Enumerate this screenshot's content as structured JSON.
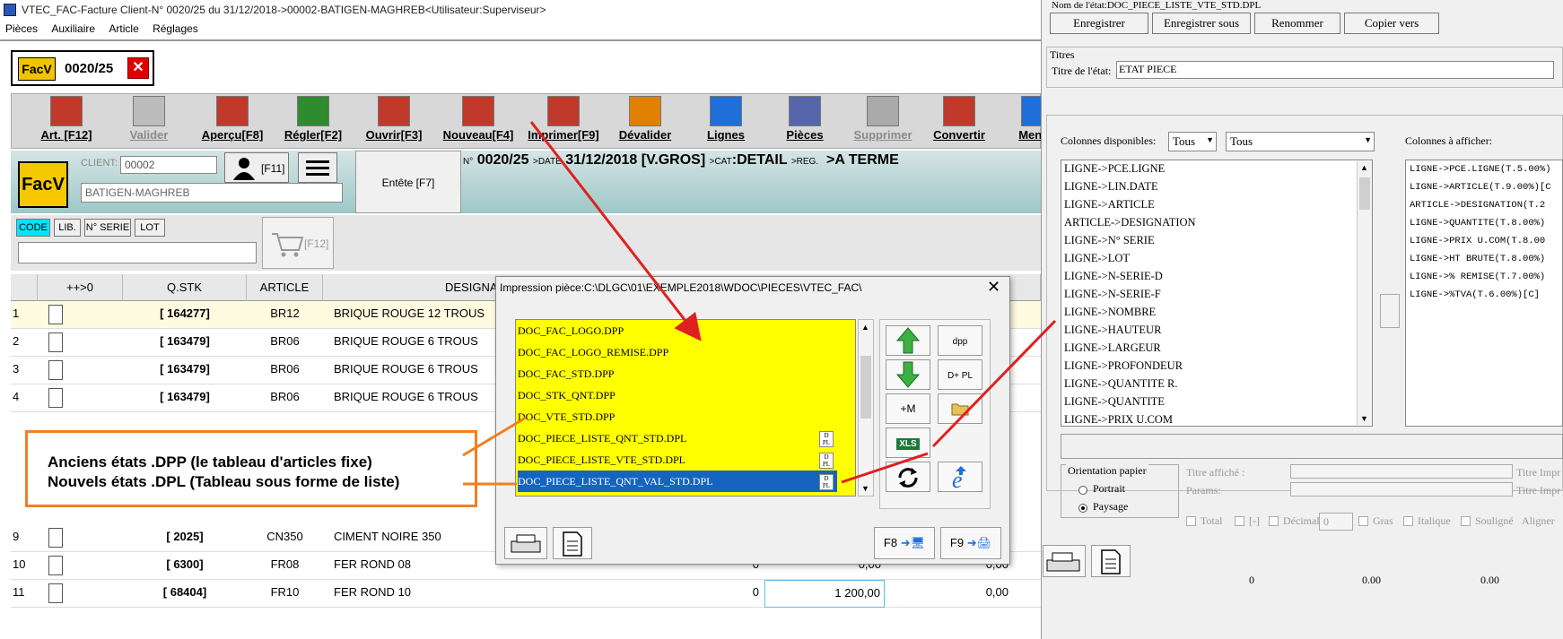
{
  "window": {
    "title": "VTEC_FAC-Facture Client-N° 0020/25 du 31/12/2018->00002-BATIGEN-MAGHREB<Utilisateur:Superviseur>",
    "menu": [
      "Pièces",
      "Auxiliaire",
      "Article",
      "Réglages"
    ]
  },
  "doc_tab": {
    "badge": "FacV",
    "number": "0020/25"
  },
  "toolbar": [
    {
      "label": "Art. [F12]",
      "icon": "article-icon",
      "enabled": true
    },
    {
      "label": "Valider",
      "icon": "validate-icon",
      "enabled": false
    },
    {
      "label": "Aperçu[F8]",
      "icon": "preview-icon",
      "enabled": true
    },
    {
      "label": "Régler[F2]",
      "icon": "money-icon",
      "enabled": true
    },
    {
      "label": "Ouvrir[F3]",
      "icon": "open-icon",
      "enabled": true
    },
    {
      "label": "Nouveau[F4]",
      "icon": "new-icon",
      "enabled": true
    },
    {
      "label": "Imprimer[F9]",
      "icon": "printer-icon",
      "enabled": true
    },
    {
      "label": "Dévalider",
      "icon": "unvalidate-icon",
      "enabled": true
    },
    {
      "label": "Lignes",
      "icon": "search-icon",
      "enabled": true
    },
    {
      "label": "Pièces",
      "icon": "grid-icon",
      "enabled": true
    },
    {
      "label": "Supprimer",
      "icon": "trash-icon",
      "enabled": false
    },
    {
      "label": "Convertir",
      "icon": "convert-icon",
      "enabled": true
    },
    {
      "label": "Menu+",
      "icon": "menu-icon",
      "enabled": true
    }
  ],
  "header": {
    "badge": "FacV",
    "client_label": "CLIENT:",
    "client_code": "00002",
    "client_name": "BATIGEN-MAGHREB",
    "person_key": "[F11]",
    "entete": "Entête [F7]",
    "n_label": "N°",
    "number": "0020/25",
    "date_label": ">DATE",
    "date": "31/12/2018",
    "type": "[V.GROS]",
    "cat_label": ">CAT",
    "cat": ":DETAIL",
    "reg_label": ">REG.",
    "reg": ">A TERME"
  },
  "filters": [
    "CODE",
    "LIB.",
    "N° SERIE",
    "LOT"
  ],
  "cart_key": "[F12]",
  "grid": {
    "columns": [
      "++>0",
      "Q.STK",
      "ARTICLE",
      "DESIGNAT"
    ],
    "rows": [
      {
        "n": "1",
        "qstk": "[ 164277]",
        "art": "BR12",
        "des": "BRIQUE ROUGE 12 TROUS",
        "v1": "",
        "v2": "",
        "v3": ""
      },
      {
        "n": "2",
        "qstk": "[ 163479]",
        "art": "BR06",
        "des": "BRIQUE ROUGE 6 TROUS",
        "v1": "",
        "v2": "",
        "v3": ""
      },
      {
        "n": "3",
        "qstk": "[ 163479]",
        "art": "BR06",
        "des": "BRIQUE ROUGE 6 TROUS",
        "v1": "",
        "v2": "",
        "v3": ""
      },
      {
        "n": "4",
        "qstk": "[ 163479]",
        "art": "BR06",
        "des": "BRIQUE ROUGE 6 TROUS",
        "v1": "",
        "v2": "",
        "v3": ""
      },
      {
        "n": "9",
        "qstk": "[ 2025]",
        "art": "CN350",
        "des": "CIMENT NOIRE 350",
        "v1": "",
        "v2": "",
        "v3": ""
      },
      {
        "n": "10",
        "qstk": "[ 6300]",
        "art": "FR08",
        "des": "FER ROND 08",
        "v1": "0",
        "v2": "0,00",
        "v3": "0,00"
      },
      {
        "n": "11",
        "qstk": "[ 68404]",
        "art": "FR10",
        "des": "FER ROND 10",
        "v1": "0",
        "v2": "1 200,00",
        "v3": "0,00"
      }
    ]
  },
  "dialog": {
    "title": "Impression pièce:C:\\DLGC\\01\\EXEMPLE2018\\WDOC\\PIECES\\VTEC_FAC\\",
    "items": [
      {
        "name": "DOC_FAC_LOGO.DPP",
        "dpl": false,
        "selected": false
      },
      {
        "name": "DOC_FAC_LOGO_REMISE.DPP",
        "dpl": false,
        "selected": false
      },
      {
        "name": "DOC_FAC_STD.DPP",
        "dpl": false,
        "selected": false
      },
      {
        "name": "DOC_STK_QNT.DPP",
        "dpl": false,
        "selected": false
      },
      {
        "name": "DOC_VTE_STD.DPP",
        "dpl": false,
        "selected": false
      },
      {
        "name": "DOC_PIECE_LISTE_QNT_STD.DPL",
        "dpl": true,
        "selected": false
      },
      {
        "name": "DOC_PIECE_LISTE_VTE_STD.DPL",
        "dpl": true,
        "selected": false
      },
      {
        "name": "DOC_PIECE_LISTE_QNT_VAL_STD.DPL",
        "dpl": true,
        "selected": true
      }
    ],
    "tool_labels": {
      "dpp": "dpp",
      "dpl": "D+ PL",
      "plus_m": "+M",
      "xls": "XLS"
    },
    "f8": "F8",
    "f9": "F9"
  },
  "callout": {
    "line1": "Anciens états .DPP (le tableau d'articles fixe)",
    "line2": "Nouvels états .DPL (Tableau sous forme de liste)"
  },
  "right": {
    "name_label": "Nom de l'état:",
    "name_value": "DOC_PIECE_LISTE_VTE_STD.DPL",
    "buttons": [
      "Enregistrer",
      "Enregistrer sous",
      "Renommer",
      "Copier vers"
    ],
    "titres_label": "Titres",
    "titre_label": "Titre de l'état:",
    "titre_value": "ETAT PIECE",
    "dispo_label": "Colonnes disponibles:",
    "select1": "Tous",
    "select2": "Tous",
    "afficher_label": "Colonnes à afficher:",
    "available": [
      "LIGNE->PCE.LIGNE",
      "LIGNE->LIN.DATE",
      "LIGNE->ARTICLE",
      "ARTICLE->DESIGNATION",
      "LIGNE->N° SERIE",
      "LIGNE->LOT",
      "LIGNE->N-SERIE-D",
      "LIGNE->N-SERIE-F",
      "LIGNE->NOMBRE",
      "LIGNE->HAUTEUR",
      "LIGNE->LARGEUR",
      "LIGNE->PROFONDEUR",
      "LIGNE->QUANTITE R.",
      "LIGNE->QUANTITE",
      "LIGNE->PRIX U.COM"
    ],
    "shown": [
      "LIGNE->PCE.LIGNE(T.5.00%)",
      "LIGNE->ARTICLE(T.9.00%)[C",
      "ARTICLE->DESIGNATION(T.2",
      "LIGNE->QUANTITE(T.8.00%)",
      "LIGNE->PRIX U.COM(T.8.00",
      "LIGNE->HT BRUTE(T.8.00%)",
      "LIGNE->% REMISE(T.7.00%)",
      "LIGNE->%TVA(T.6.00%)[C]"
    ],
    "orientation_label": "Orientation papier",
    "portrait": "Portrait",
    "paysage": "Paysage",
    "titre_affiche": "Titre affiché :",
    "params": "Params:",
    "titre_impr1": "Titre Impr",
    "titre_impr2": "Titre Impr",
    "opts": [
      "Total",
      "[-]",
      "Décimales :",
      "Gras",
      "Italique",
      "Souligné",
      "Aligner"
    ],
    "decimales": "0",
    "bottom_nums": [
      "0",
      "0.00",
      "0.00"
    ]
  },
  "colors": {
    "accent": "#f2c300",
    "selection": "#1565c0",
    "list_bg": "#ffff00",
    "callout": "#f08020",
    "arrow": "#e02020"
  }
}
